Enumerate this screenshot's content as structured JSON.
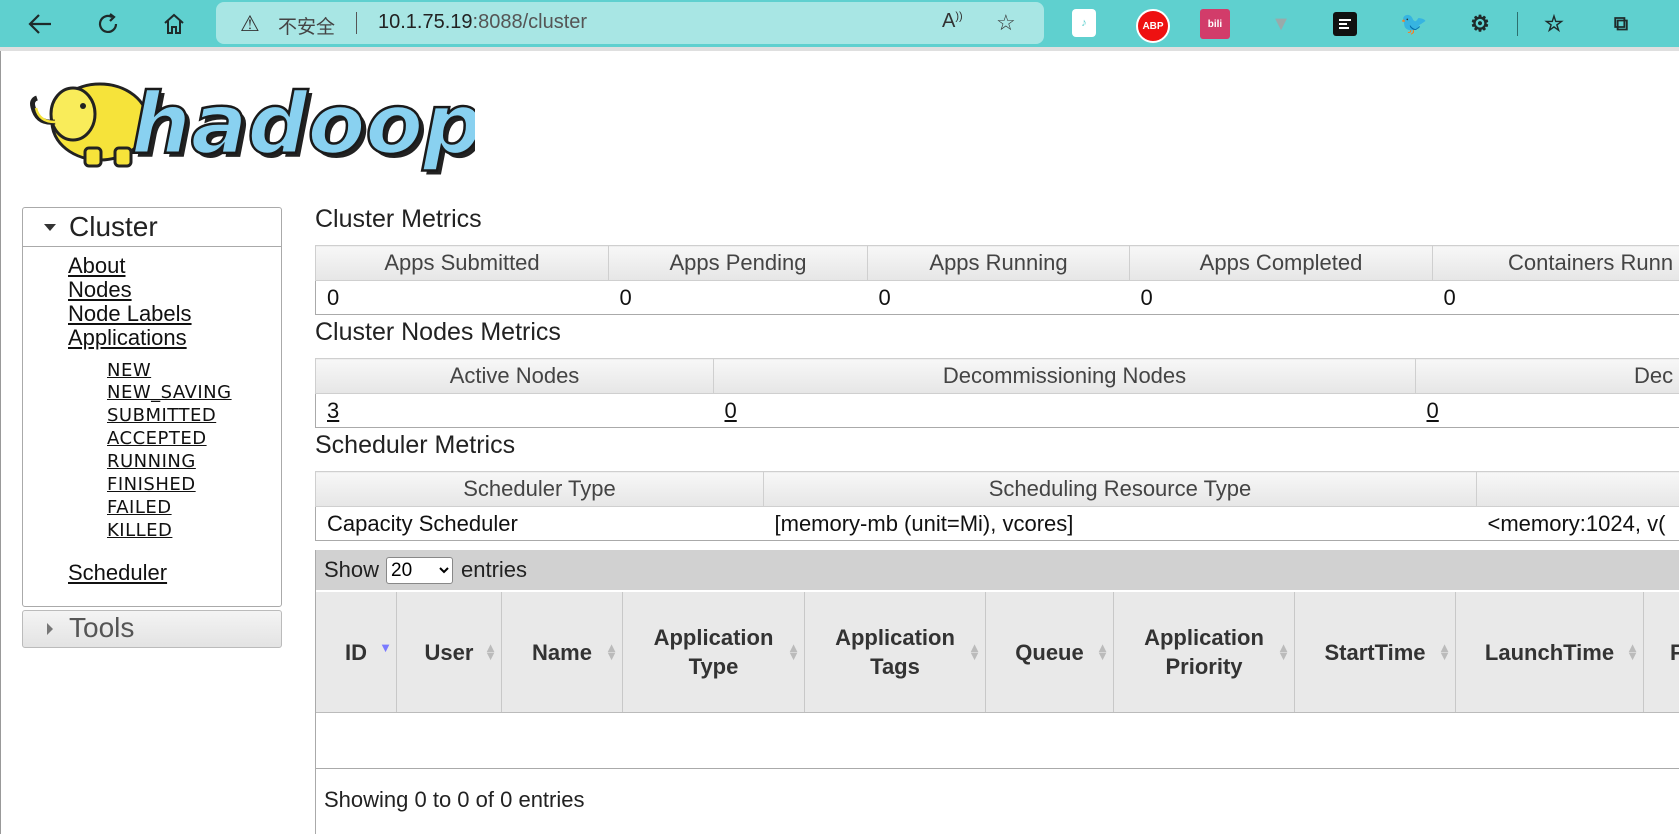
{
  "browser": {
    "security_label": "不安全",
    "url_host": "10.1.75.19",
    "url_rest": ":8088/cluster",
    "ext_abp": "ABP",
    "ext_bili": "bili"
  },
  "logo_text": "hadoop",
  "sidebar": {
    "cluster_title": "Cluster",
    "links": [
      "About",
      "Nodes",
      "Node Labels",
      "Applications"
    ],
    "app_states": [
      "NEW",
      "NEW_SAVING",
      "SUBMITTED",
      "ACCEPTED",
      "RUNNING",
      "FINISHED",
      "FAILED",
      "KILLED"
    ],
    "scheduler": "Scheduler",
    "tools_title": "Tools"
  },
  "cluster_metrics": {
    "title": "Cluster Metrics",
    "headers": [
      "Apps Submitted",
      "Apps Pending",
      "Apps Running",
      "Apps Completed",
      "Containers Runn"
    ],
    "values": [
      "0",
      "0",
      "0",
      "0",
      "0"
    ]
  },
  "nodes_metrics": {
    "title": "Cluster Nodes Metrics",
    "headers": [
      "Active Nodes",
      "Decommissioning Nodes",
      "Dec"
    ],
    "values": [
      "3",
      "0",
      "0"
    ]
  },
  "scheduler_metrics": {
    "title": "Scheduler Metrics",
    "headers": [
      "Scheduler Type",
      "Scheduling Resource Type",
      ""
    ],
    "values": [
      "Capacity Scheduler",
      "[memory-mb (unit=Mi), vcores]",
      "<memory:1024, v("
    ]
  },
  "apps_table": {
    "show_label": "Show",
    "entries_label": "entries",
    "page_size": "20",
    "columns": [
      "ID",
      "User",
      "Name",
      "Application Type",
      "Application Tags",
      "Queue",
      "Application Priority",
      "StartTime",
      "LaunchTime",
      "F"
    ],
    "info": "Showing 0 to 0 of 0 entries"
  }
}
